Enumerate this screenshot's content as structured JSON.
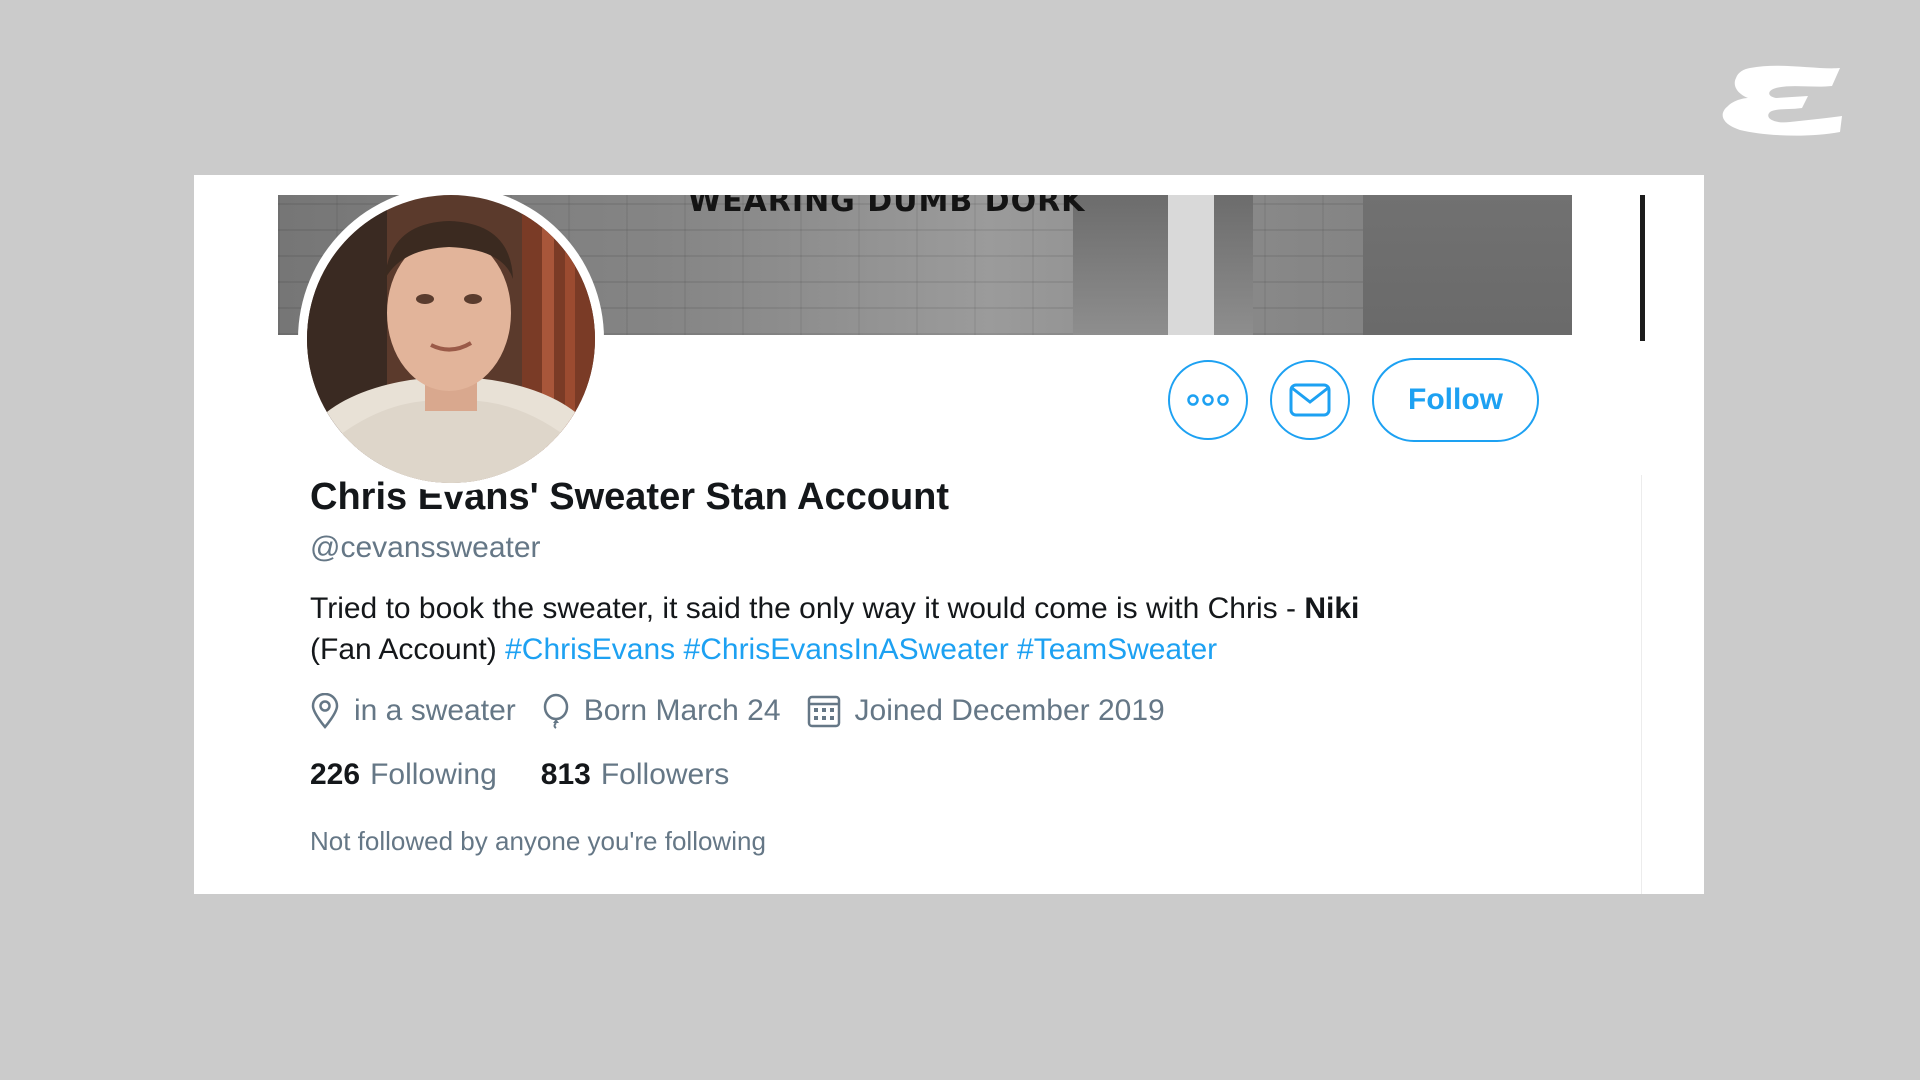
{
  "brand": {
    "logo_icon": "esquire-e-logo",
    "color": "#ffffff"
  },
  "profile": {
    "banner_caption": "WEARING DUMB DORK",
    "display_name": "Chris Evans' Sweater Stan Account",
    "handle": "@cevanssweater",
    "bio": {
      "text": "Tried to book the sweater, it said the only way it would come is with Chris - ",
      "bold_name": "Niki",
      "suffix": "(Fan Account)",
      "hashtags": [
        "#ChrisEvans",
        "#ChrisEvansInASweater",
        "#TeamSweater"
      ]
    },
    "location": "in a sweater",
    "birthday": "Born March 24",
    "joined": "Joined December 2019",
    "following_count": "226",
    "following_label": "Following",
    "followers_count": "813",
    "followers_label": "Followers",
    "not_followed_note": "Not followed by anyone you're following"
  },
  "actions": {
    "more_icon": "more-options-icon",
    "message_icon": "envelope-icon",
    "follow_label": "Follow"
  },
  "colors": {
    "accent": "#1da1f2",
    "text_primary": "#14171a",
    "text_secondary": "#657786",
    "background": "#cbcbcb"
  }
}
